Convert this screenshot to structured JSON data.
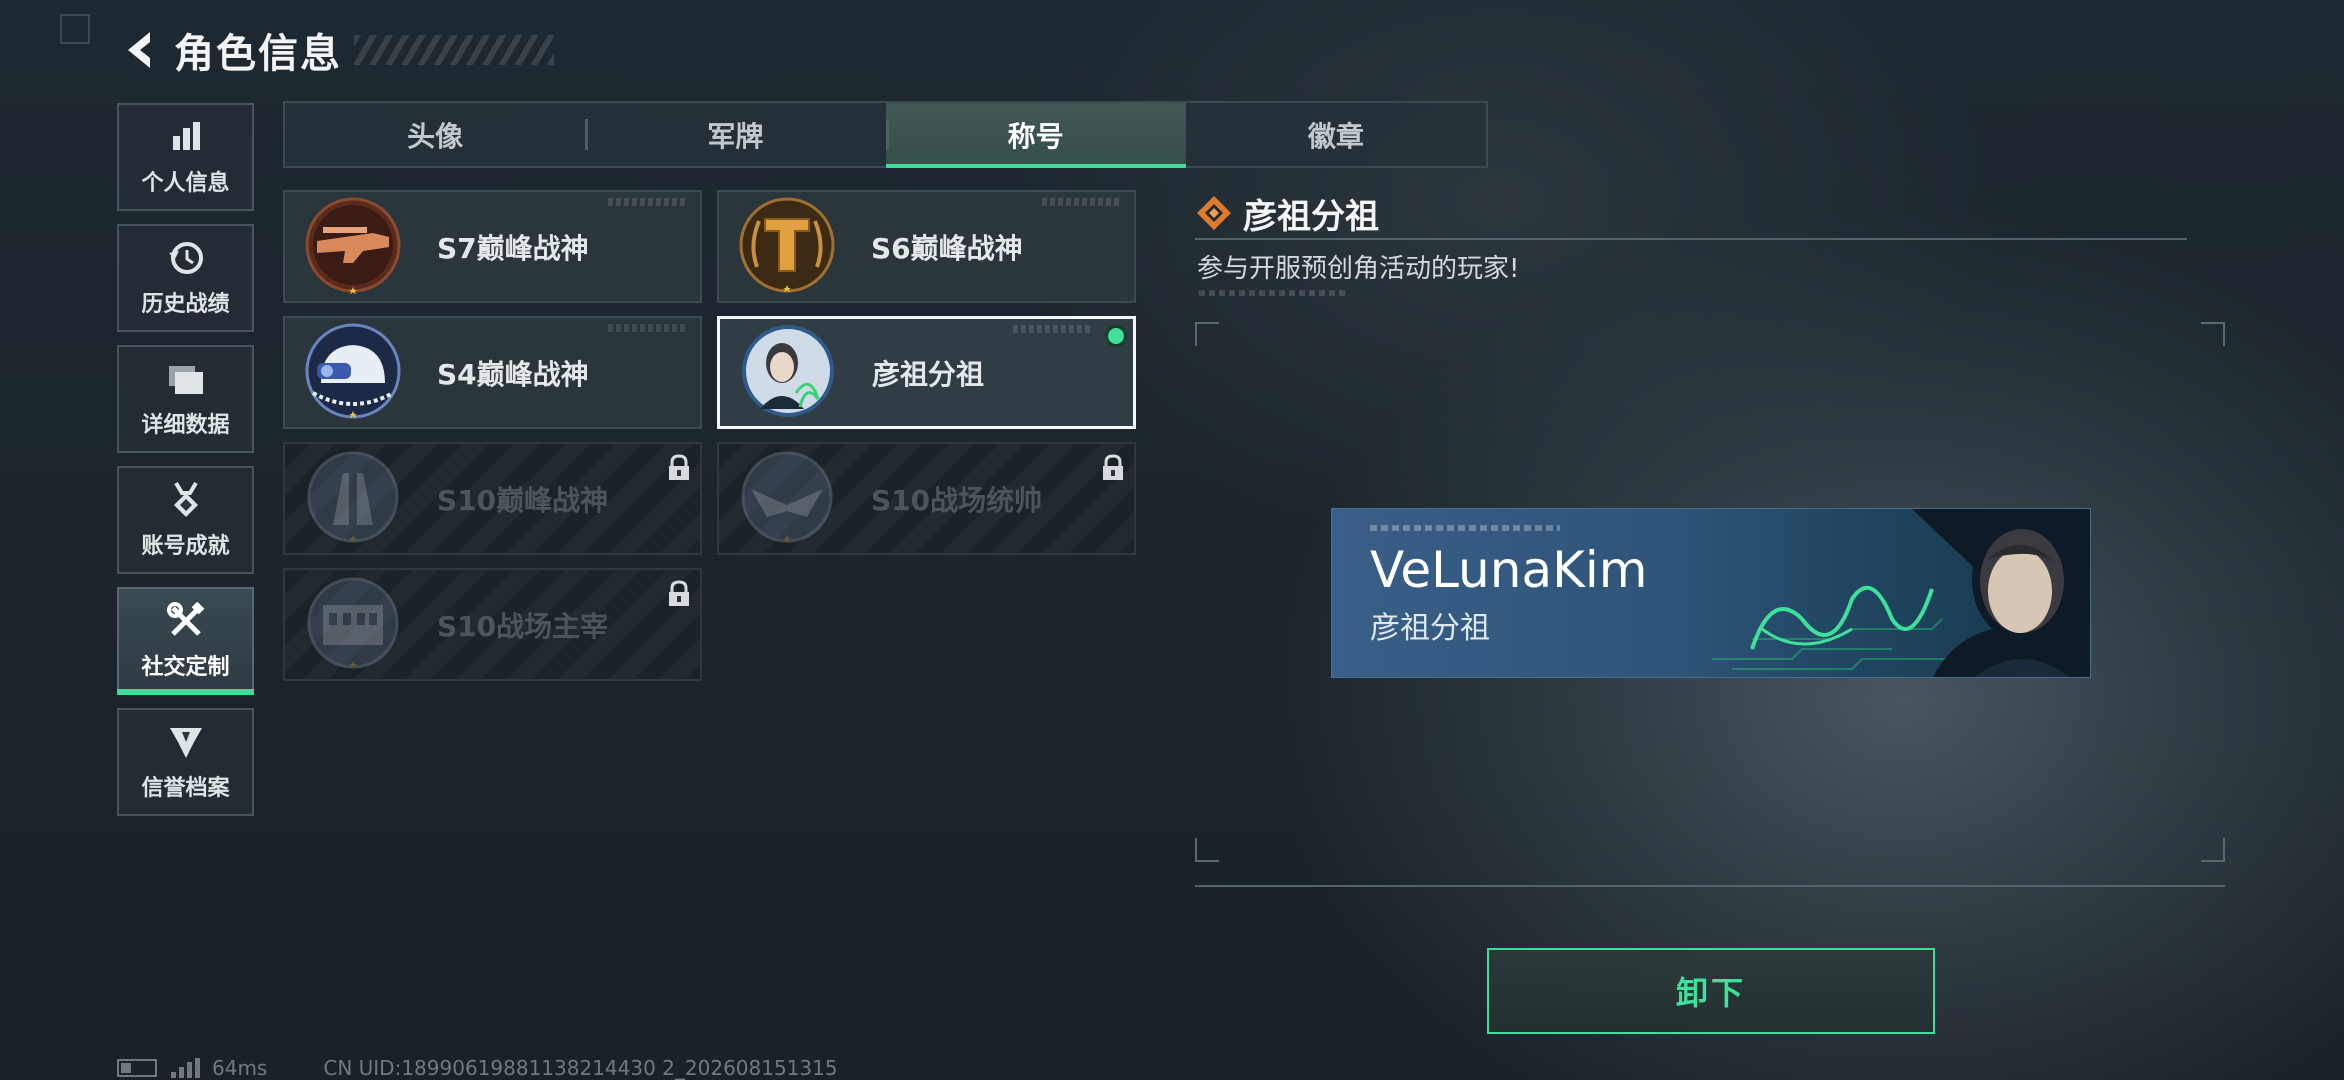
{
  "header": {
    "title": "角色信息"
  },
  "sidebar": {
    "items": [
      {
        "label": "个人信息",
        "icon": "bar-chart-icon"
      },
      {
        "label": "历史战绩",
        "icon": "history-clock-icon"
      },
      {
        "label": "详细数据",
        "icon": "folders-icon"
      },
      {
        "label": "账号成就",
        "icon": "medal-icon"
      },
      {
        "label": "社交定制",
        "icon": "wrench-screwdriver-icon",
        "active": true
      },
      {
        "label": "信誉档案",
        "icon": "shield-emblem-icon"
      }
    ]
  },
  "tabs": [
    {
      "label": "头像"
    },
    {
      "label": "军牌"
    },
    {
      "label": "称号",
      "active": true
    },
    {
      "label": "徽章"
    }
  ],
  "cards": [
    {
      "name": "S7巅峰战神",
      "emblem": "rifle-emblem-icon",
      "state": "unlocked"
    },
    {
      "name": "S6巅峰战神",
      "emblem": "gold-t-emblem-icon",
      "state": "unlocked"
    },
    {
      "name": "S4巅峰战神",
      "emblem": "helmet-emblem-icon",
      "state": "unlocked"
    },
    {
      "name": "彦祖分祖",
      "emblem": "portrait-emblem-icon",
      "state": "selected-equipped"
    },
    {
      "name": "S10巅峰战神",
      "emblem": "tower-emblem-icon",
      "state": "locked"
    },
    {
      "name": "S10战场统帅",
      "emblem": "eagle-emblem-icon",
      "state": "locked"
    },
    {
      "name": "S10战场主宰",
      "emblem": "colosseum-emblem-icon",
      "state": "locked"
    }
  ],
  "detail": {
    "title": "彦祖分祖",
    "description": "参与开服预创角活动的玩家!",
    "title_icon": "diamond-badge-icon"
  },
  "banner": {
    "player_name": "VeLunaKim",
    "title": "彦祖分祖"
  },
  "action": {
    "label": "卸下"
  },
  "status": {
    "ping": "64ms",
    "uid": "CN UID:18990619881138214430 2_202608151315"
  },
  "colors": {
    "accent": "#3fdc9a",
    "banner_blue": "#2e5478",
    "card_bg": "#2c373e"
  }
}
